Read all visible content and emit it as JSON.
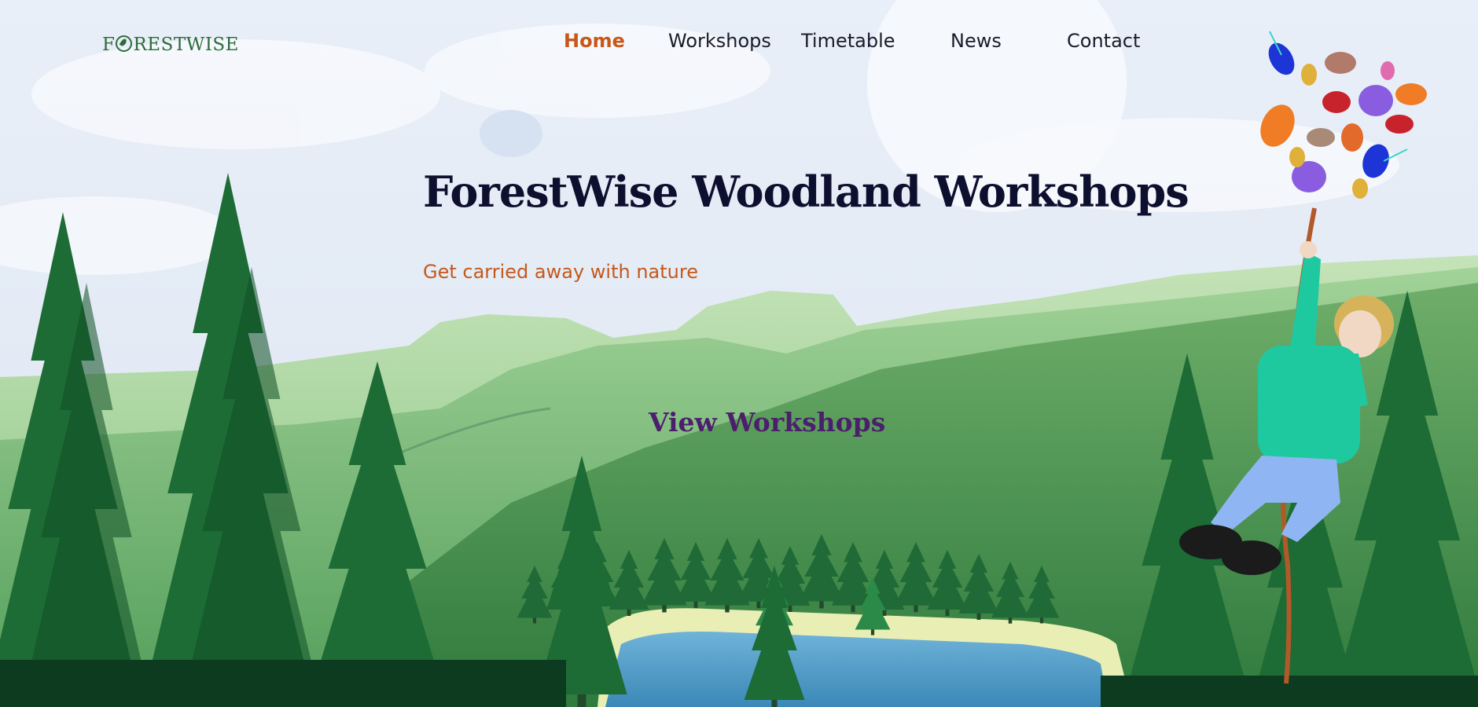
{
  "logo": {
    "text_before": "F",
    "text_after": "RESTWISE"
  },
  "nav": {
    "home": "Home",
    "workshops": "Workshops",
    "timetable": "Timetable",
    "news": "News",
    "contact": "Contact"
  },
  "hero": {
    "title": "ForestWise Woodland Workshops",
    "subtitle": "Get carried away with nature",
    "cta": "View Workshops"
  },
  "colors": {
    "accent": "#c7581a",
    "title": "#0d0f2e",
    "cta": "#4c1f6d",
    "brand_green": "#2e6b3c"
  }
}
